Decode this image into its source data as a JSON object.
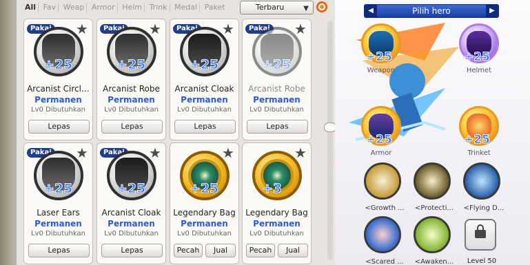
{
  "tabs": [
    "All",
    "Fav",
    "Weap",
    "Armor",
    "Helm",
    "Trink",
    "Medal",
    "Paket"
  ],
  "sort": {
    "label": "Terbaru"
  },
  "cards": [
    {
      "badge": "Pakai",
      "plus": "+25",
      "name": "Arcanist Circl…",
      "perm": "Permanen",
      "req": "Lv0 Dibutuhkan",
      "buttons": [
        "Lepas"
      ],
      "icon": "arcanist-circlet-icon"
    },
    {
      "badge": "Pakai",
      "plus": "+25",
      "name": "Arcanist Robe",
      "perm": "Permanen",
      "req": "Lv0 Dibutuhkan",
      "buttons": [
        "Lepas"
      ],
      "icon": "arcanist-robe-icon"
    },
    {
      "badge": "Pakai",
      "plus": "+25",
      "name": "Arcanist Cloak",
      "perm": "Permanen",
      "req": "Lv0 Dibutuhkan",
      "buttons": [
        "Lepas"
      ],
      "icon": "arcanist-cloak-icon"
    },
    {
      "badge": "Pakai",
      "plus": "+25",
      "name": "Arcanist Robe",
      "perm": "Permanen",
      "req": "Lv0 Dibutuhkan",
      "buttons": [
        "Lepas"
      ],
      "icon": "arcanist-robe-icon"
    },
    {
      "badge": "Pakai",
      "plus": "+25",
      "name": "Laser Ears",
      "perm": "Permanen",
      "req": "Lv0 Dibutuhkan",
      "buttons": [
        "Lepas"
      ],
      "icon": "laser-ears-icon"
    },
    {
      "badge": "Pakai",
      "plus": "+25",
      "name": "Arcanist Cloak",
      "perm": "Permanen",
      "req": "Lv0 Dibutuhkan",
      "buttons": [
        "Lepas"
      ],
      "icon": "arcanist-cloak-icon"
    },
    {
      "badge": "",
      "plus": "+25",
      "name": "Legendary Bag",
      "perm": "Permanen",
      "req": "Lv0 Dibutuhkan",
      "buttons": [
        "Pecah",
        "Jual"
      ],
      "icon": "legendary-bag-icon"
    },
    {
      "badge": "",
      "plus": "+3",
      "name": "Legendary Bag",
      "perm": "Permanen",
      "req": "Lv0 Dibutuhkan",
      "buttons": [
        "Pecah",
        "Jual"
      ],
      "icon": "legendary-bag-icon"
    }
  ],
  "hero": {
    "title": "Pilih hero",
    "prev": "◀",
    "next": "▶"
  },
  "slots": [
    {
      "plus": "+25",
      "label": "Weapon"
    },
    {
      "plus": "+25",
      "label": "Helmet"
    },
    {
      "plus": "+25",
      "label": "Armor"
    },
    {
      "plus": "+25",
      "label": "Trinket"
    }
  ],
  "medals": [
    {
      "label": "<Growth ..."
    },
    {
      "label": "<Protecti..."
    },
    {
      "label": "<Flying D..."
    },
    {
      "label": "<Scared ..."
    },
    {
      "label": "<Awaken..."
    }
  ],
  "lock": {
    "label": "Level 50"
  },
  "colors": {
    "accent": "#2e5ad1",
    "badge": "#1e3d8c",
    "hero_bar": "#2a55c2",
    "gold": "#f2b51b"
  }
}
